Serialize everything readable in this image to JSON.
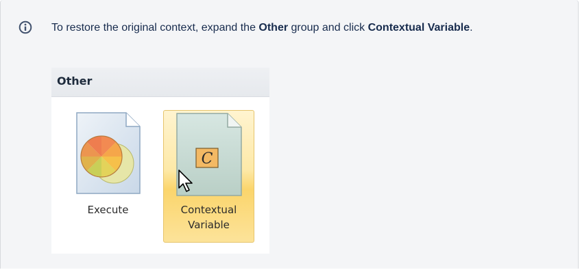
{
  "note": {
    "text_before": "To restore the original context, expand the ",
    "group_name": "Other",
    "text_middle": " group and click ",
    "item_name": "Contextual Variable",
    "text_after": "."
  },
  "palette": {
    "group_title": "Other",
    "items": [
      {
        "label": "Execute",
        "icon": "execute-icon",
        "selected": false
      },
      {
        "label_line1": "Contextual",
        "label_line2": "Variable",
        "icon": "contextual-variable-icon",
        "glyph": "C",
        "selected": true
      }
    ]
  },
  "colors": {
    "info_icon": "#42526e",
    "selection_gold": "#fbd56c",
    "panel_background": "#f4f5f7"
  }
}
